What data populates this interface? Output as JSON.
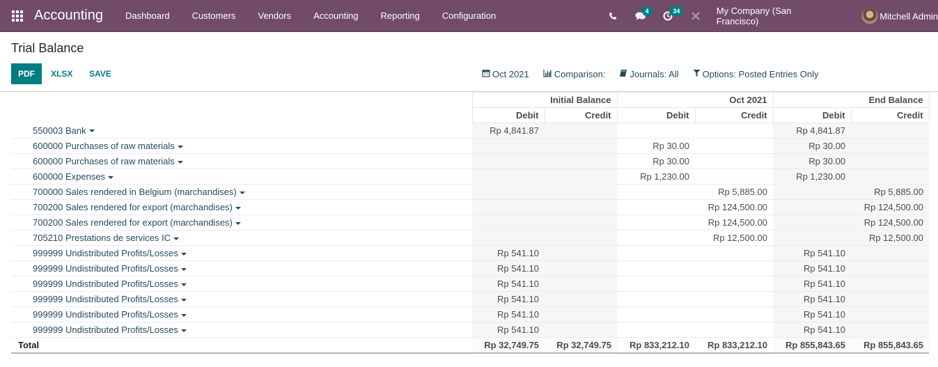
{
  "navbar": {
    "app_title": "Accounting",
    "menu": [
      "Dashboard",
      "Customers",
      "Vendors",
      "Accounting",
      "Reporting",
      "Configuration"
    ],
    "messages_count": "4",
    "activities_count": "34",
    "company": "My Company (San Francisco)",
    "user": "Mitchell Admin"
  },
  "page": {
    "title": "Trial Balance",
    "buttons": {
      "pdf": "PDF",
      "xlsx": "XLSX",
      "save": "SAVE"
    },
    "filters": {
      "date": "Oct 2021",
      "comparison": "Comparison:",
      "journals": "Journals: All",
      "options": "Options: Posted Entries Only"
    }
  },
  "table": {
    "groups": [
      "Initial Balance",
      "Oct 2021",
      "End Balance"
    ],
    "subheaders": [
      "Debit",
      "Credit",
      "Debit",
      "Credit",
      "Debit",
      "Credit"
    ],
    "rows": [
      {
        "account": "550003 Bank",
        "values": [
          "Rp 4,841.87",
          "",
          "",
          "",
          "Rp 4,841.87",
          ""
        ]
      },
      {
        "account": "600000 Purchases of raw materials",
        "values": [
          "",
          "",
          "Rp 30.00",
          "",
          "Rp 30.00",
          ""
        ]
      },
      {
        "account": "600000 Purchases of raw materials",
        "values": [
          "",
          "",
          "Rp 30.00",
          "",
          "Rp 30.00",
          ""
        ]
      },
      {
        "account": "600000 Expenses",
        "values": [
          "",
          "",
          "Rp 1,230.00",
          "",
          "Rp 1,230.00",
          ""
        ]
      },
      {
        "account": "700000 Sales rendered in Belgium (marchandises)",
        "values": [
          "",
          "",
          "",
          "Rp 5,885.00",
          "",
          "Rp 5,885.00"
        ]
      },
      {
        "account": "700200 Sales rendered for export (marchandises)",
        "values": [
          "",
          "",
          "",
          "Rp 124,500.00",
          "",
          "Rp 124,500.00"
        ]
      },
      {
        "account": "700200 Sales rendered for export (marchandises)",
        "values": [
          "",
          "",
          "",
          "Rp 124,500.00",
          "",
          "Rp 124,500.00"
        ]
      },
      {
        "account": "705210 Prestations de services IC",
        "values": [
          "",
          "",
          "",
          "Rp 12,500.00",
          "",
          "Rp 12,500.00"
        ]
      },
      {
        "account": "999999 Undistributed Profits/Losses",
        "values": [
          "Rp 541.10",
          "",
          "",
          "",
          "Rp 541.10",
          ""
        ]
      },
      {
        "account": "999999 Undistributed Profits/Losses",
        "values": [
          "Rp 541.10",
          "",
          "",
          "",
          "Rp 541.10",
          ""
        ]
      },
      {
        "account": "999999 Undistributed Profits/Losses",
        "values": [
          "Rp 541.10",
          "",
          "",
          "",
          "Rp 541.10",
          ""
        ]
      },
      {
        "account": "999999 Undistributed Profits/Losses",
        "values": [
          "Rp 541.10",
          "",
          "",
          "",
          "Rp 541.10",
          ""
        ]
      },
      {
        "account": "999999 Undistributed Profits/Losses",
        "values": [
          "Rp 541.10",
          "",
          "",
          "",
          "Rp 541.10",
          ""
        ]
      },
      {
        "account": "999999 Undistributed Profits/Losses",
        "values": [
          "Rp 541.10",
          "",
          "",
          "",
          "Rp 541.10",
          ""
        ]
      }
    ],
    "total": {
      "label": "Total",
      "values": [
        "Rp 32,749.75",
        "Rp 32,749.75",
        "Rp 833,212.10",
        "Rp 833,212.10",
        "Rp 855,843.65",
        "Rp 855,843.65"
      ]
    }
  }
}
